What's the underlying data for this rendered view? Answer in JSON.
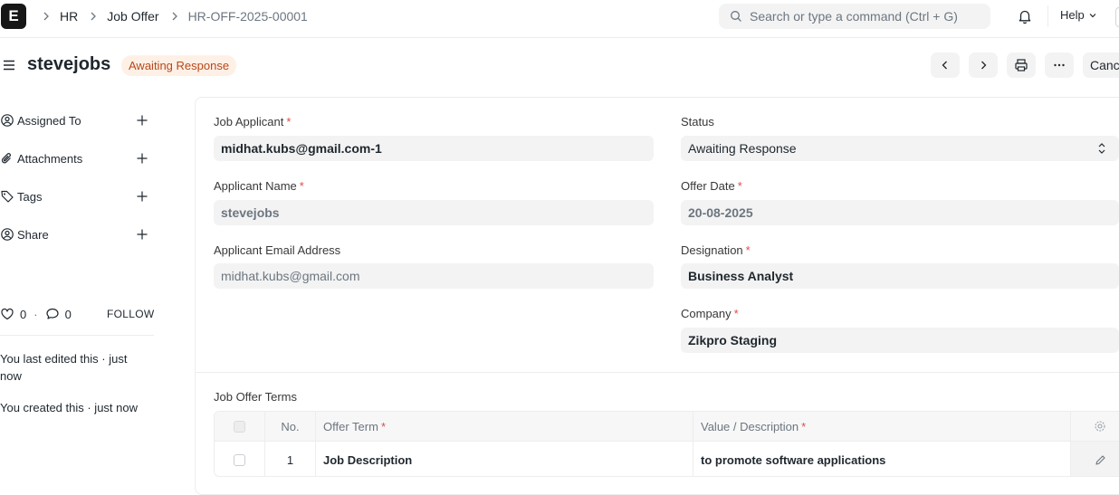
{
  "navbar": {
    "logo_letter": "E",
    "breadcrumbs": [
      "HR",
      "Job Offer",
      "HR-OFF-2025-00001"
    ],
    "search_placeholder": "Search or type a command (Ctrl + G)",
    "help_label": "Help"
  },
  "page_head": {
    "title": "stevejobs",
    "status": "Awaiting Response",
    "cancel_label": "Cancel"
  },
  "sidebar": {
    "items": [
      {
        "label": "Assigned To",
        "icon": "assign-icon"
      },
      {
        "label": "Attachments",
        "icon": "paperclip-icon"
      },
      {
        "label": "Tags",
        "icon": "tag-icon"
      },
      {
        "label": "Share",
        "icon": "share-icon"
      }
    ],
    "likes_count": "0",
    "comments_count": "0",
    "follow_label": "FOLLOW",
    "activity": [
      "You last edited this · just now",
      "You created this · just now"
    ]
  },
  "form": {
    "job_applicant_label": "Job Applicant",
    "job_applicant_value": "midhat.kubs@gmail.com-1",
    "applicant_name_label": "Applicant Name",
    "applicant_name_value": "stevejobs",
    "applicant_email_label": "Applicant Email Address",
    "applicant_email_value": "midhat.kubs@gmail.com",
    "status_label": "Status",
    "status_value": "Awaiting Response",
    "offer_date_label": "Offer Date",
    "offer_date_value": "20-08-2025",
    "designation_label": "Designation",
    "designation_value": "Business Analyst",
    "company_label": "Company",
    "company_value": "Zikpro Staging",
    "required_mark": "*"
  },
  "terms": {
    "section_label": "Job Offer Terms",
    "columns": [
      "No.",
      "Offer Term",
      "Value / Description"
    ],
    "rows": [
      {
        "no": "1",
        "term": "Job Description",
        "value": "to promote software applications"
      }
    ]
  },
  "colors": {
    "status_bg": "#fff0e6",
    "status_text": "#b5481b",
    "required": "#e24c4c",
    "field_bg": "#f3f3f3"
  }
}
